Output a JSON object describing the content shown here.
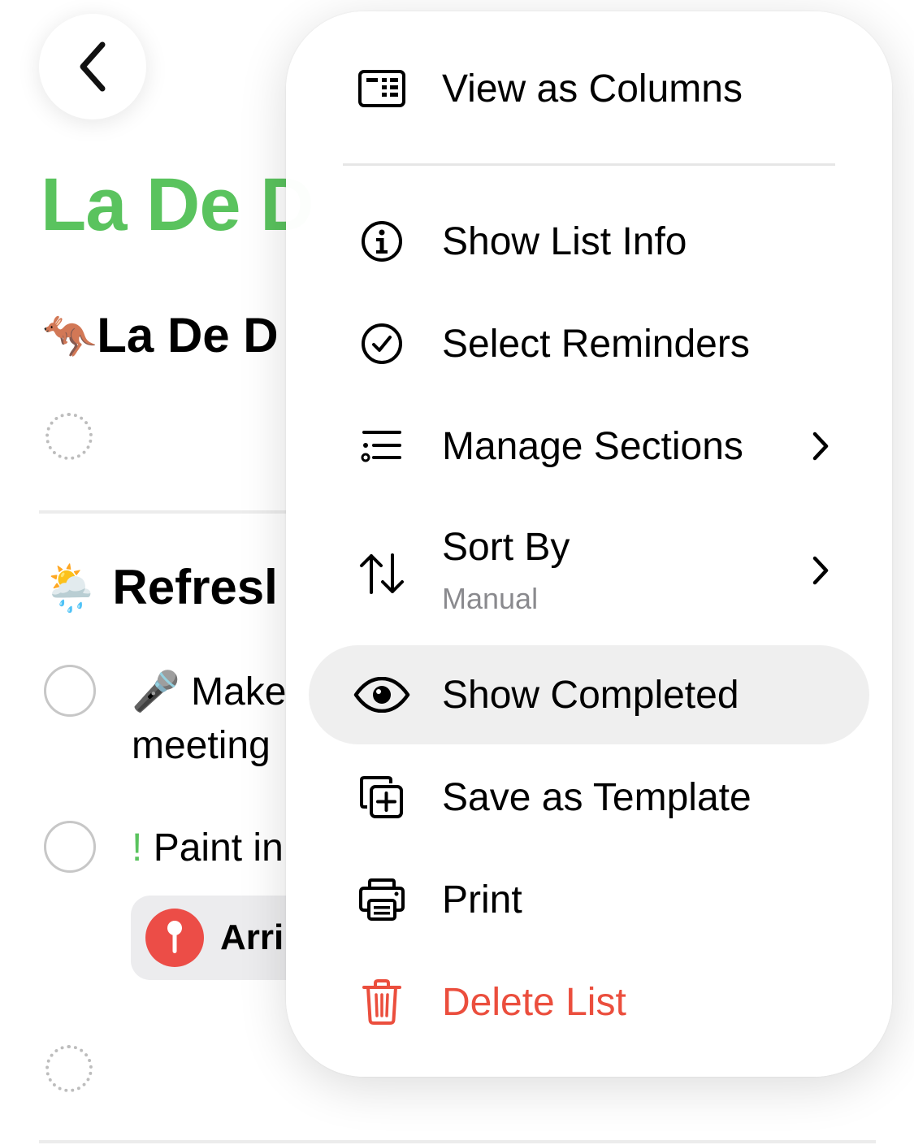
{
  "background": {
    "back_icon": "chevron-left-icon",
    "list_title": "La De D",
    "section1": {
      "emoji": "🦘",
      "title": "La De D"
    },
    "section2": {
      "emoji": "🌦️",
      "title": "Refresl"
    },
    "reminders": [
      {
        "emoji": "🎤",
        "text_line1": "Make",
        "text_line2": "meeting"
      },
      {
        "priority": "!",
        "text_line1": "Paint in"
      }
    ],
    "location_chip": {
      "icon": "location-pin-icon",
      "label": "Arri"
    },
    "accent_color": "#5ac35e"
  },
  "menu": {
    "items": [
      {
        "label": "View as Columns",
        "icon": "columns-icon"
      },
      {
        "label": "Show List Info",
        "icon": "info-circle-icon"
      },
      {
        "label": "Select Reminders",
        "icon": "checkmark-circle-icon"
      },
      {
        "label": "Manage Sections",
        "icon": "sections-list-icon",
        "has_submenu": true
      },
      {
        "label": "Sort By",
        "sublabel": "Manual",
        "icon": "sort-arrows-icon",
        "has_submenu": true
      },
      {
        "label": "Show Completed",
        "icon": "eye-icon",
        "highlighted": true
      },
      {
        "label": "Save as Template",
        "icon": "add-template-icon"
      },
      {
        "label": "Print",
        "icon": "printer-icon"
      },
      {
        "label": "Delete List",
        "icon": "trash-icon",
        "destructive": true,
        "color": "#eb4e3d"
      }
    ]
  }
}
